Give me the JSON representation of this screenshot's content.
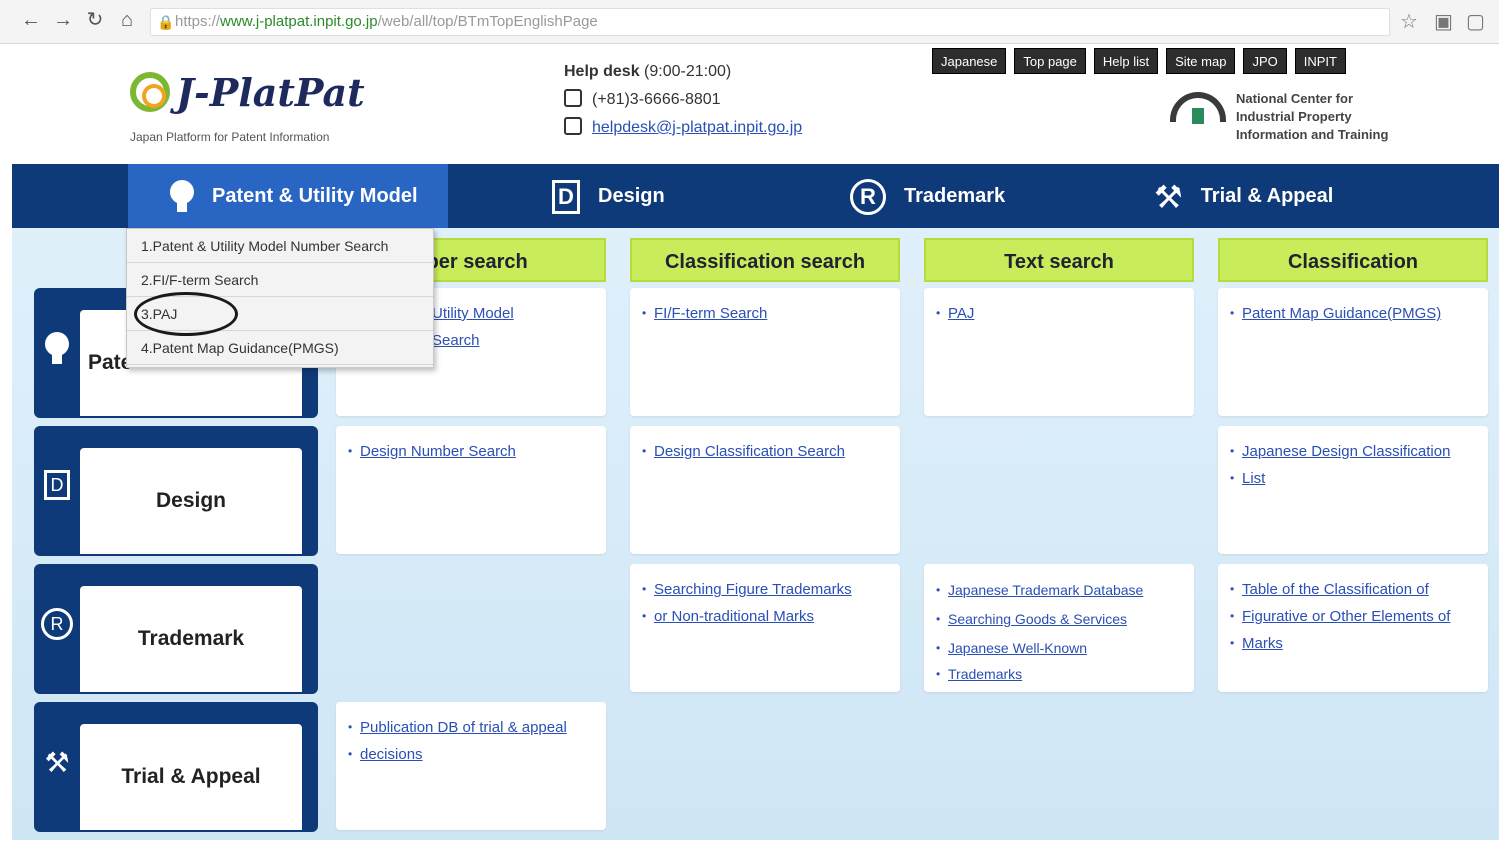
{
  "browser": {
    "url_scheme": "https://",
    "url_host": "www.j-platpat.inpit.go.jp",
    "url_path": "/web/all/top/BTmTopEnglishPage",
    "back_icon": "arrow-left-icon",
    "forward_icon": "arrow-right-icon",
    "reload_icon": "reload-icon",
    "home_icon": "home-icon"
  },
  "header": {
    "logo_text": "J-PlatPat",
    "logo_sub": "Japan Platform for Patent Information",
    "helpdesk_label": "Help desk",
    "helpdesk_hours": "(9:00-21:00)",
    "phone": "(+81)3-6666-8801",
    "email": "helpdesk@j-platpat.inpit.go.jp",
    "top_buttons": [
      "Japanese",
      "Top page",
      "Help list",
      "Site map",
      "JPO",
      "INPIT"
    ],
    "org_line1": "National Center for",
    "org_line2": "Industrial Property",
    "org_line3": "Information and Training"
  },
  "nav": {
    "items": [
      {
        "label": "Patent & Utility Model",
        "icon": "lightbulb-icon"
      },
      {
        "label": "Design",
        "icon": "design-d-icon"
      },
      {
        "label": "Trademark",
        "icon": "registered-icon"
      },
      {
        "label": "Trial & Appeal",
        "icon": "gavel-icon"
      }
    ]
  },
  "dropdown": {
    "items": [
      "1.Patent & Utility Model Number Search",
      "2.FI/F-term Search",
      "3.PAJ",
      "4.Patent Map Guidance(PMGS)"
    ]
  },
  "columns": [
    "nber search",
    "Classification search",
    "Text search",
    "Classification"
  ],
  "rows": {
    "patent": {
      "label": "Pate",
      "number": [
        "Utility Model",
        "Search"
      ],
      "classification": [
        "FI/F-term Search"
      ],
      "text": [
        "PAJ"
      ],
      "class2": [
        "Patent Map Guidance(PMGS)"
      ]
    },
    "design": {
      "label": "Design",
      "number": [
        "Design Number Search"
      ],
      "classification": [
        "Design Classification Search"
      ],
      "class2": [
        "Japanese Design Classification",
        "List"
      ]
    },
    "trademark": {
      "label": "Trademark",
      "classification": [
        "Searching Figure Trademarks",
        "or Non-traditional Marks"
      ],
      "text": [
        "Japanese Trademark Database",
        "Searching Goods & Services",
        "Japanese Well-Known",
        "Trademarks"
      ],
      "class2": [
        "Table of the Classification of",
        "Figurative or Other Elements of",
        "Marks"
      ]
    },
    "trial": {
      "label": "Trial & Appeal",
      "number": [
        "Publication DB of trial & appeal",
        "decisions"
      ]
    }
  },
  "colors": {
    "nav_bg": "#0f3a7a",
    "nav_active": "#2966c4",
    "col_header": "#c9ed5a",
    "link": "#2a4fb5"
  }
}
